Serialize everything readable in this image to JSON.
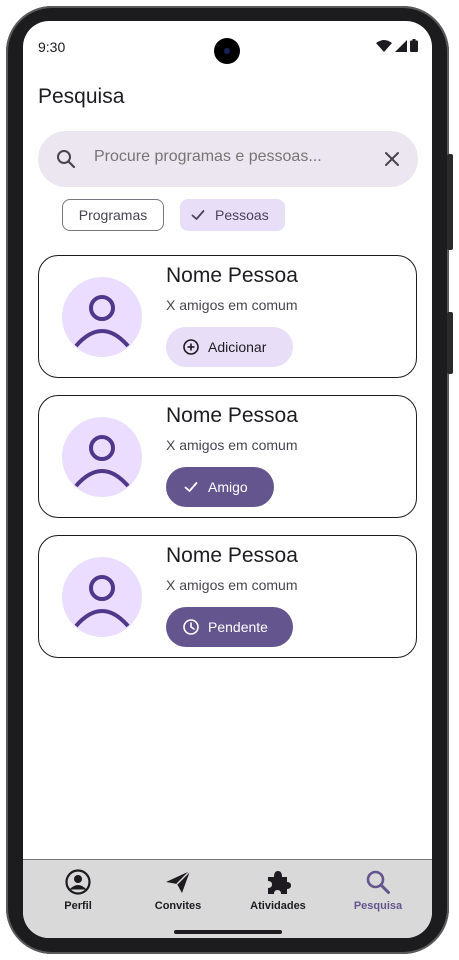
{
  "status_bar": {
    "time": "9:30"
  },
  "header": {
    "title": "Pesquisa"
  },
  "search": {
    "placeholder": "Procure programas e pessoas...",
    "value": ""
  },
  "filters": [
    {
      "label": "Programas",
      "selected": false
    },
    {
      "label": "Pessoas",
      "selected": true
    }
  ],
  "results": [
    {
      "name": "Nome Pessoa",
      "mutual": "X amigos em comum",
      "action": "Adicionar",
      "action_icon": "add-circle-icon"
    },
    {
      "name": "Nome Pessoa",
      "mutual": "X amigos em comum",
      "action": "Amigo",
      "action_icon": "check-icon"
    },
    {
      "name": "Nome Pessoa",
      "mutual": "X amigos em comum",
      "action": "Pendente",
      "action_icon": "clock-icon"
    }
  ],
  "nav": [
    {
      "label": "Perfil",
      "icon": "account-circle-icon",
      "active": false
    },
    {
      "label": "Convites",
      "icon": "send-icon",
      "active": false
    },
    {
      "label": "Atividades",
      "icon": "puzzle-icon",
      "active": false
    },
    {
      "label": "Pesquisa",
      "icon": "search-icon",
      "active": true
    }
  ],
  "colors": {
    "primary": "#65558f",
    "secondary_container": "#e8def8",
    "surface_container": "#ece6f0",
    "avatar_bg": "#eaddff"
  }
}
